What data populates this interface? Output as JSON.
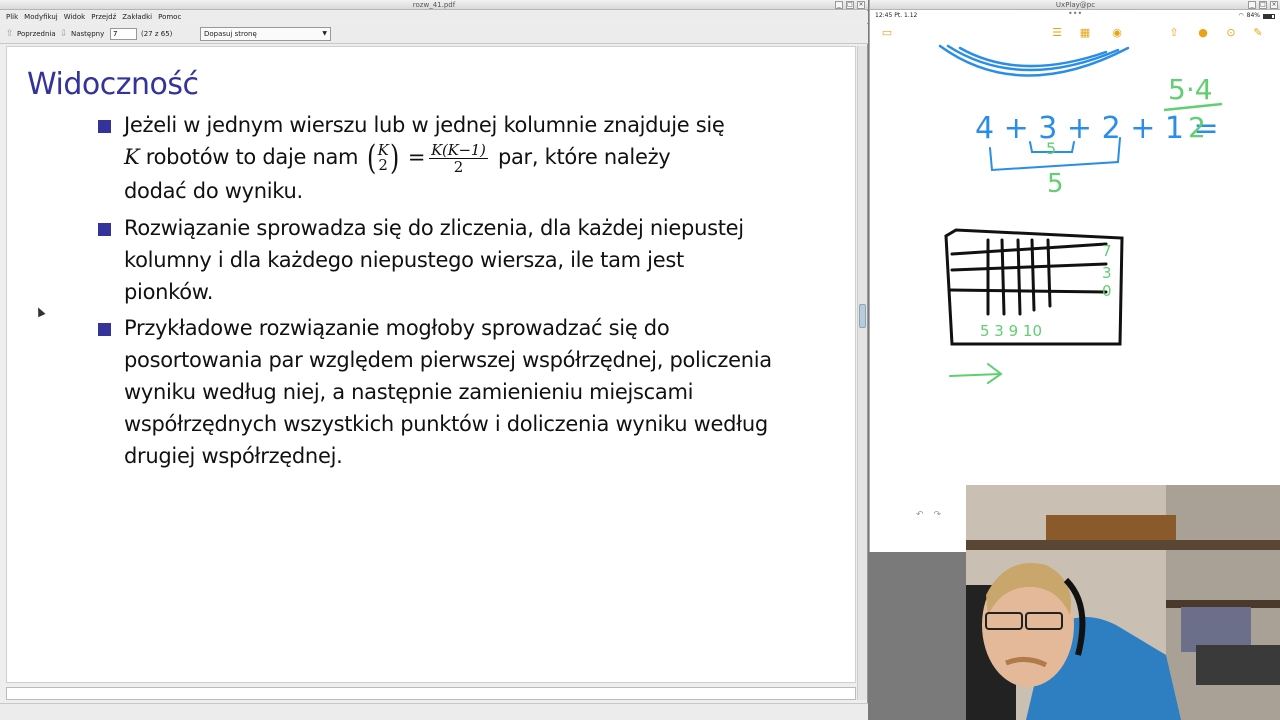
{
  "pdf_viewer": {
    "window_title": "rozw_41.pdf",
    "menu": [
      "Plik",
      "Modyfikuj",
      "Widok",
      "Przejdź",
      "Zakładki",
      "Pomoc"
    ],
    "toolbar": {
      "prev_label": "Poprzednia",
      "next_label": "Następny",
      "page_value": "7",
      "page_count": "(27 z 65)",
      "zoom_value": "Dopasuj stronę"
    },
    "slide": {
      "title": "Widoczność",
      "bullets": [
        {
          "line1": "Jeżeli w jednym wierszu lub w jednej kolumnie znajduje się",
          "math_K": "K",
          "mid_text": " robotów to daje nam ",
          "binom_top": "K",
          "binom_bottom": "2",
          "equals": "=",
          "frac_num": "K(K−1)",
          "frac_den": "2",
          "after_text": " par, które należy",
          "line3": "dodać do wyniku."
        },
        {
          "text": "Rozwiązanie sprowadza się do zliczenia, dla każdej niepustej kolumny i dla każdego niepustego wiersza, ile tam jest pionków."
        },
        {
          "text": "Przykładowe rozwiązanie mogłoby sprowadzać się do posortowania par względem pierwszej współrzędnej, policzenia wyniku według niej, a następnie zamienieniu miejscami współrzędnych wszystkich punktów i doliczenia wyniku według drugiej współrzędnej."
        }
      ]
    }
  },
  "uxplay": {
    "window_title": "UxPlay@pc",
    "status_time": "12:45",
    "status_date": "Pt. 1.12",
    "status_battery": "84%",
    "handwriting": {
      "sum_left": "4 + 3 + 2 + 1 =",
      "frac_top": "5·4",
      "frac_bottom": "2",
      "brace_small": "5",
      "brace_big": "5",
      "row_counts": [
        "7",
        "3",
        "0"
      ],
      "col_counts": "5 3 9 10"
    },
    "icon_colors": {
      "accent": "#e8a317",
      "green_ink": "#5fcf6f",
      "blue_ink": "#2a8ee6"
    }
  },
  "webcam": {
    "label": "webcam-feed"
  },
  "icons": {
    "close": "×",
    "maximize": "□",
    "minimize": "_",
    "prev": "⇧",
    "next": "⇩",
    "caret": "▼"
  }
}
